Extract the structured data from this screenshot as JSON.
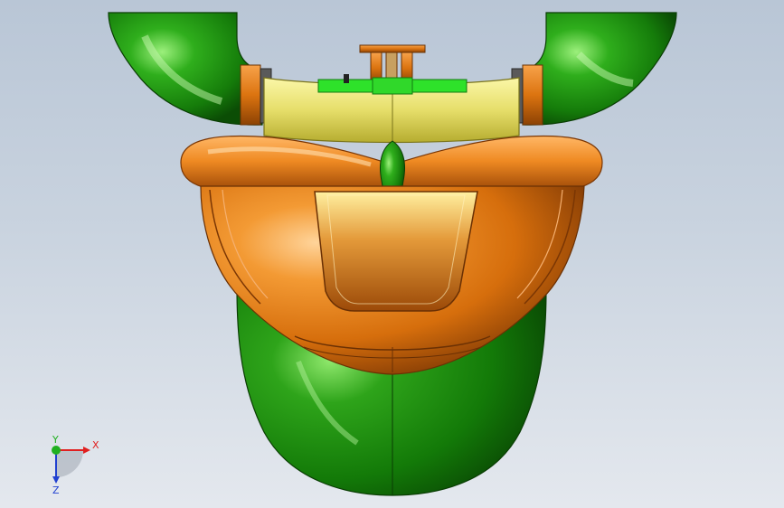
{
  "viewport": {
    "background_top": "#b9c6d6",
    "background_bottom": "#e4e8ee"
  },
  "model": {
    "colors": {
      "green": "#1f9a12",
      "green_dark": "#0d5a06",
      "green_light": "#8ee86a",
      "orange": "#e57a12",
      "orange_dark": "#8a3f05",
      "orange_light": "#ffc27a",
      "yellow": "#e8e070",
      "yellow_dark": "#a69e2a",
      "bright_green": "#2ee22a",
      "gray": "#6a6a6a"
    }
  },
  "triad": {
    "x_label": "X",
    "y_label": "Y",
    "z_label": "Z",
    "x_color": "#e02020",
    "y_color": "#20b020",
    "z_color": "#2040d0"
  }
}
